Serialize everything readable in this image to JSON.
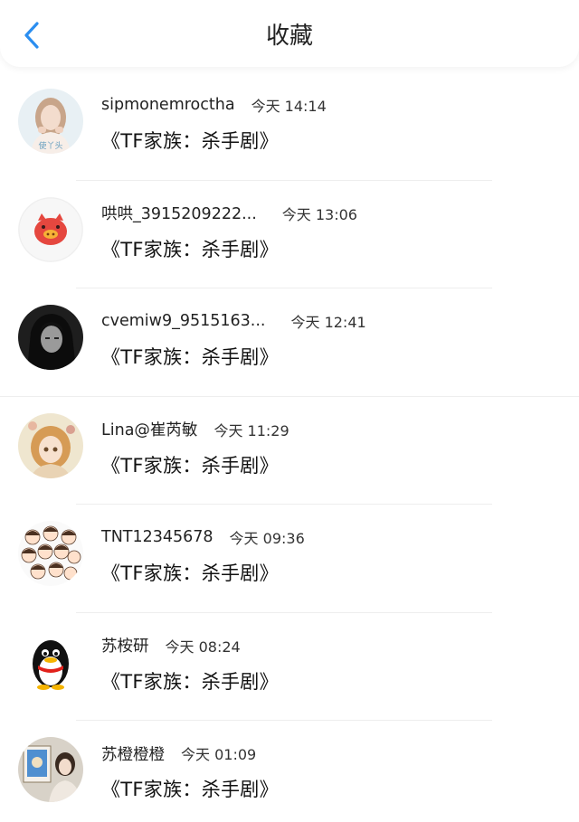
{
  "header": {
    "title": "收藏",
    "back_icon": "chevron-left-icon",
    "accent": "#2b8ef0"
  },
  "items": [
    {
      "username": "sipmonemroctha",
      "time": "今天 14:14",
      "content": "《TF家族：杀手剧》",
      "avatar": "avatar-photo-girl",
      "avatar_caption": "使丫头"
    },
    {
      "username": "哄哄_3915209222...",
      "time": "今天 13:06",
      "content": "《TF家族：杀手剧》",
      "avatar": "avatar-pig"
    },
    {
      "username": "cvemiw9_9515163...",
      "time": "今天 12:41",
      "content": "《TF家族：杀手剧》",
      "avatar": "avatar-dark-anime"
    },
    {
      "username": "Lina@崔芮敏",
      "time": "今天 11:29",
      "content": "《TF家族：杀手剧》",
      "avatar": "avatar-anime-girl"
    },
    {
      "username": "TNT12345678",
      "time": "今天 09:36",
      "content": "《TF家族：杀手剧》",
      "avatar": "avatar-cartoon-group"
    },
    {
      "username": "苏桉研",
      "time": "今天 08:24",
      "content": "《TF家族：杀手剧》",
      "avatar": "avatar-penguin"
    },
    {
      "username": "苏橙橙橙",
      "time": "今天 01:09",
      "content": "《TF家族：杀手剧》",
      "avatar": "avatar-photo-painting"
    }
  ]
}
